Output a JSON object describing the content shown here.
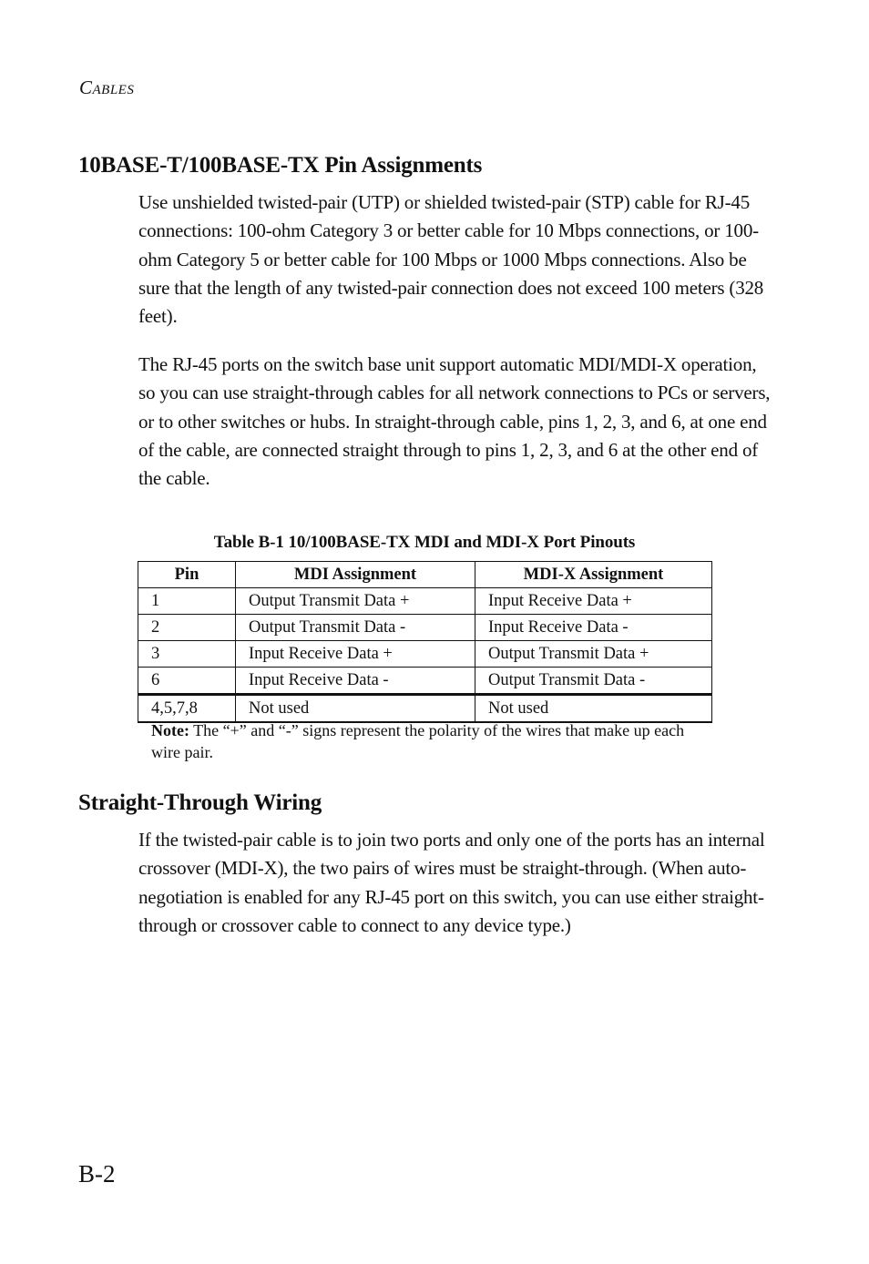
{
  "running_head": {
    "initial": "C",
    "rest": "ABLES"
  },
  "section1": {
    "heading": "10BASE-T/100BASE-TX Pin Assignments",
    "paragraphs": [
      "Use unshielded twisted-pair (UTP) or shielded twisted-pair (STP) cable for RJ-45 connections: 100-ohm Category 3 or better cable for 10 Mbps connections, or 100-ohm Category 5 or better cable for 100 Mbps or 1000 Mbps connections. Also be sure that the length of any twisted-pair connection does not exceed 100 meters (328 feet).",
      "The RJ-45 ports on the switch base unit support automatic MDI/MDI-X operation, so you can use straight-through cables for all network connections to PCs or servers, or to other switches or hubs. In straight-through cable, pins 1, 2, 3, and 6, at one end of the cable, are connected straight through to pins 1, 2, 3, and 6 at the other end of the cable."
    ]
  },
  "table": {
    "caption": "Table B-1  10/100BASE-TX MDI and MDI-X Port Pinouts",
    "headers": [
      "Pin",
      "MDI Assignment",
      "MDI-X Assignment"
    ],
    "rows": [
      [
        "1",
        "Output Transmit Data +",
        "Input Receive Data +"
      ],
      [
        "2",
        "Output Transmit Data -",
        "Input Receive Data -"
      ],
      [
        "3",
        "Input Receive Data +",
        "Output Transmit Data +"
      ],
      [
        "6",
        "Input Receive Data -",
        "Output Transmit Data -"
      ],
      [
        "4,5,7,8",
        "Not used",
        "Not used"
      ]
    ],
    "note_label": "Note:",
    "note_text": " The “+” and “-” signs represent the polarity of the wires that make up each wire pair."
  },
  "section2": {
    "heading": "Straight-Through Wiring",
    "paragraphs": [
      "If the twisted-pair cable is to join two ports and only one of the ports has an internal crossover (MDI-X), the two pairs of wires must be straight-through. (When auto-negotiation is enabled for any RJ-45 port on this switch, you can use either straight-through or crossover cable to connect to any device type.)"
    ]
  },
  "page_number": "B-2"
}
